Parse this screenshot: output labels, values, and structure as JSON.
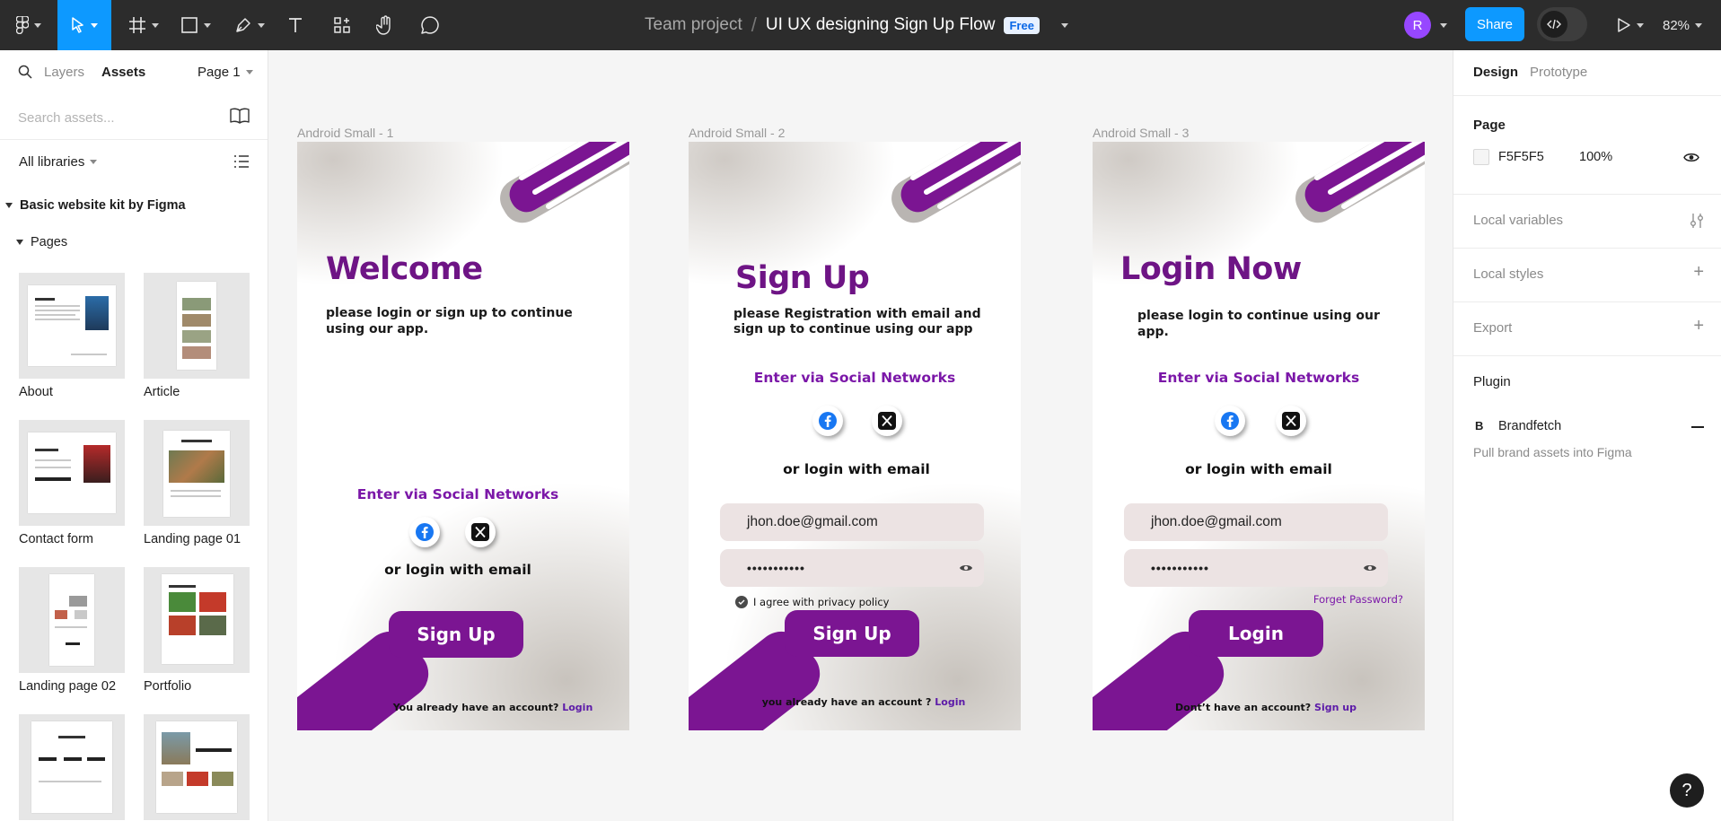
{
  "toolbar": {
    "breadcrumb_team": "Team project",
    "breadcrumb_sep": "/",
    "file_name": "UI UX designing Sign Up Flow",
    "plan_badge": "Free",
    "avatar_initial": "R",
    "share_label": "Share",
    "zoom": "82%",
    "tools": [
      "main-menu",
      "move",
      "frame",
      "shape",
      "pen",
      "text",
      "actions",
      "hand",
      "comment"
    ]
  },
  "left_panel": {
    "tabs": {
      "layers": "Layers",
      "assets": "Assets"
    },
    "page_selector": "Page 1",
    "search_placeholder": "Search assets...",
    "libraries_label": "All libraries",
    "kit_title": "Basic website kit by Figma",
    "pages_label": "Pages",
    "thumbnails": [
      {
        "label": "About"
      },
      {
        "label": "Article"
      },
      {
        "label": "Contact form"
      },
      {
        "label": "Landing page 01"
      },
      {
        "label": "Landing page 02"
      },
      {
        "label": "Portfolio"
      },
      {
        "label": ""
      },
      {
        "label": ""
      }
    ]
  },
  "canvas": {
    "frames": [
      {
        "label": "Android Small - 1",
        "title": "Welcome",
        "subtitle": "please login or sign up to continue using our app.",
        "social_heading": "Enter via Social Networks",
        "or_login": "or login with email",
        "button": "Sign Up",
        "footer_text": "You already have an account?",
        "footer_link": "Login"
      },
      {
        "label": "Android Small - 2",
        "title": "Sign Up",
        "subtitle": "please Registration with email and sign up to continue using our app",
        "social_heading": "Enter via Social Networks",
        "or_login": "or login with email",
        "email_value": "jhon.doe@gmail.com",
        "password_value": "•••••••••••",
        "agree_text": "I agree with privacy policy",
        "button": "Sign Up",
        "footer_text": "you  already have an account ?",
        "footer_link": "Login"
      },
      {
        "label": "Android Small - 3",
        "title": "Login Now",
        "subtitle": "please login to continue using our app.",
        "social_heading": "Enter via Social Networks",
        "or_login": "or login with email",
        "email_value": "jhon.doe@gmail.com",
        "password_value": "•••••••••••",
        "forgot": "Forget Password?",
        "button": "Login",
        "footer_text": "Dont’t have an account?",
        "footer_link": "Sign up"
      }
    ]
  },
  "right_panel": {
    "tabs": {
      "design": "Design",
      "prototype": "Prototype"
    },
    "page_heading": "Page",
    "page_color": "F5F5F5",
    "page_opacity": "100%",
    "local_variables": "Local variables",
    "local_styles": "Local styles",
    "export": "Export",
    "plugin_heading": "Plugin",
    "plugin_name": "Brandfetch",
    "plugin_desc": "Pull brand assets into Figma",
    "help": "?"
  },
  "colors": {
    "toolbar_bg": "#2c2c2c",
    "accent_blue": "#0d99ff",
    "brand_purple": "#7b1592",
    "title_purple": "#6e1485",
    "canvas_bg": "#f5f5f5"
  }
}
